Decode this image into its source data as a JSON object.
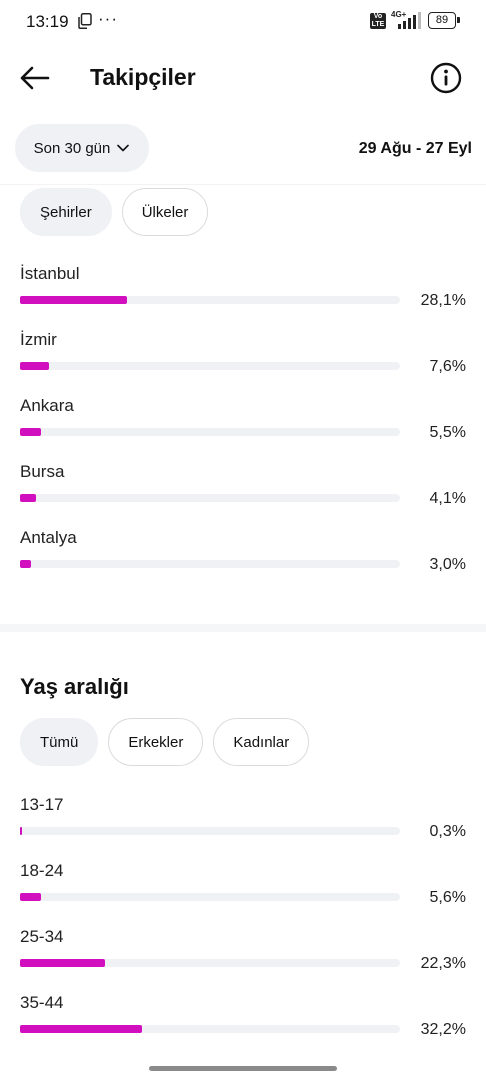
{
  "status_bar": {
    "time": "13:19",
    "dots": "···",
    "volte": "Vo LTE",
    "network": "4G+",
    "battery": "89"
  },
  "header": {
    "title": "Takipçiler"
  },
  "filter": {
    "range_label": "Son 30 gün",
    "date_range": "29 Ağu - 27 Eyl"
  },
  "location": {
    "tabs": [
      {
        "label": "Şehirler",
        "active": true
      },
      {
        "label": "Ülkeler",
        "active": false
      }
    ],
    "items": [
      {
        "label": "İstanbul",
        "value": "28,1%",
        "percent": 28.1
      },
      {
        "label": "İzmir",
        "value": "7,6%",
        "percent": 7.6
      },
      {
        "label": "Ankara",
        "value": "5,5%",
        "percent": 5.5
      },
      {
        "label": "Bursa",
        "value": "4,1%",
        "percent": 4.1
      },
      {
        "label": "Antalya",
        "value": "3,0%",
        "percent": 3.0
      }
    ]
  },
  "age": {
    "title": "Yaş aralığı",
    "tabs": [
      {
        "label": "Tümü",
        "active": true
      },
      {
        "label": "Erkekler",
        "active": false
      },
      {
        "label": "Kadınlar",
        "active": false
      }
    ],
    "items": [
      {
        "label": "13-17",
        "value": "0,3%",
        "percent": 0.3
      },
      {
        "label": "18-24",
        "value": "5,6%",
        "percent": 5.6
      },
      {
        "label": "25-34",
        "value": "22,3%",
        "percent": 22.3
      },
      {
        "label": "35-44",
        "value": "32,2%",
        "percent": 32.2
      }
    ]
  },
  "colors": {
    "bar_fill": "#d20fbe",
    "bar_track": "#eff1f4",
    "chip_active": "#eff1f4"
  }
}
